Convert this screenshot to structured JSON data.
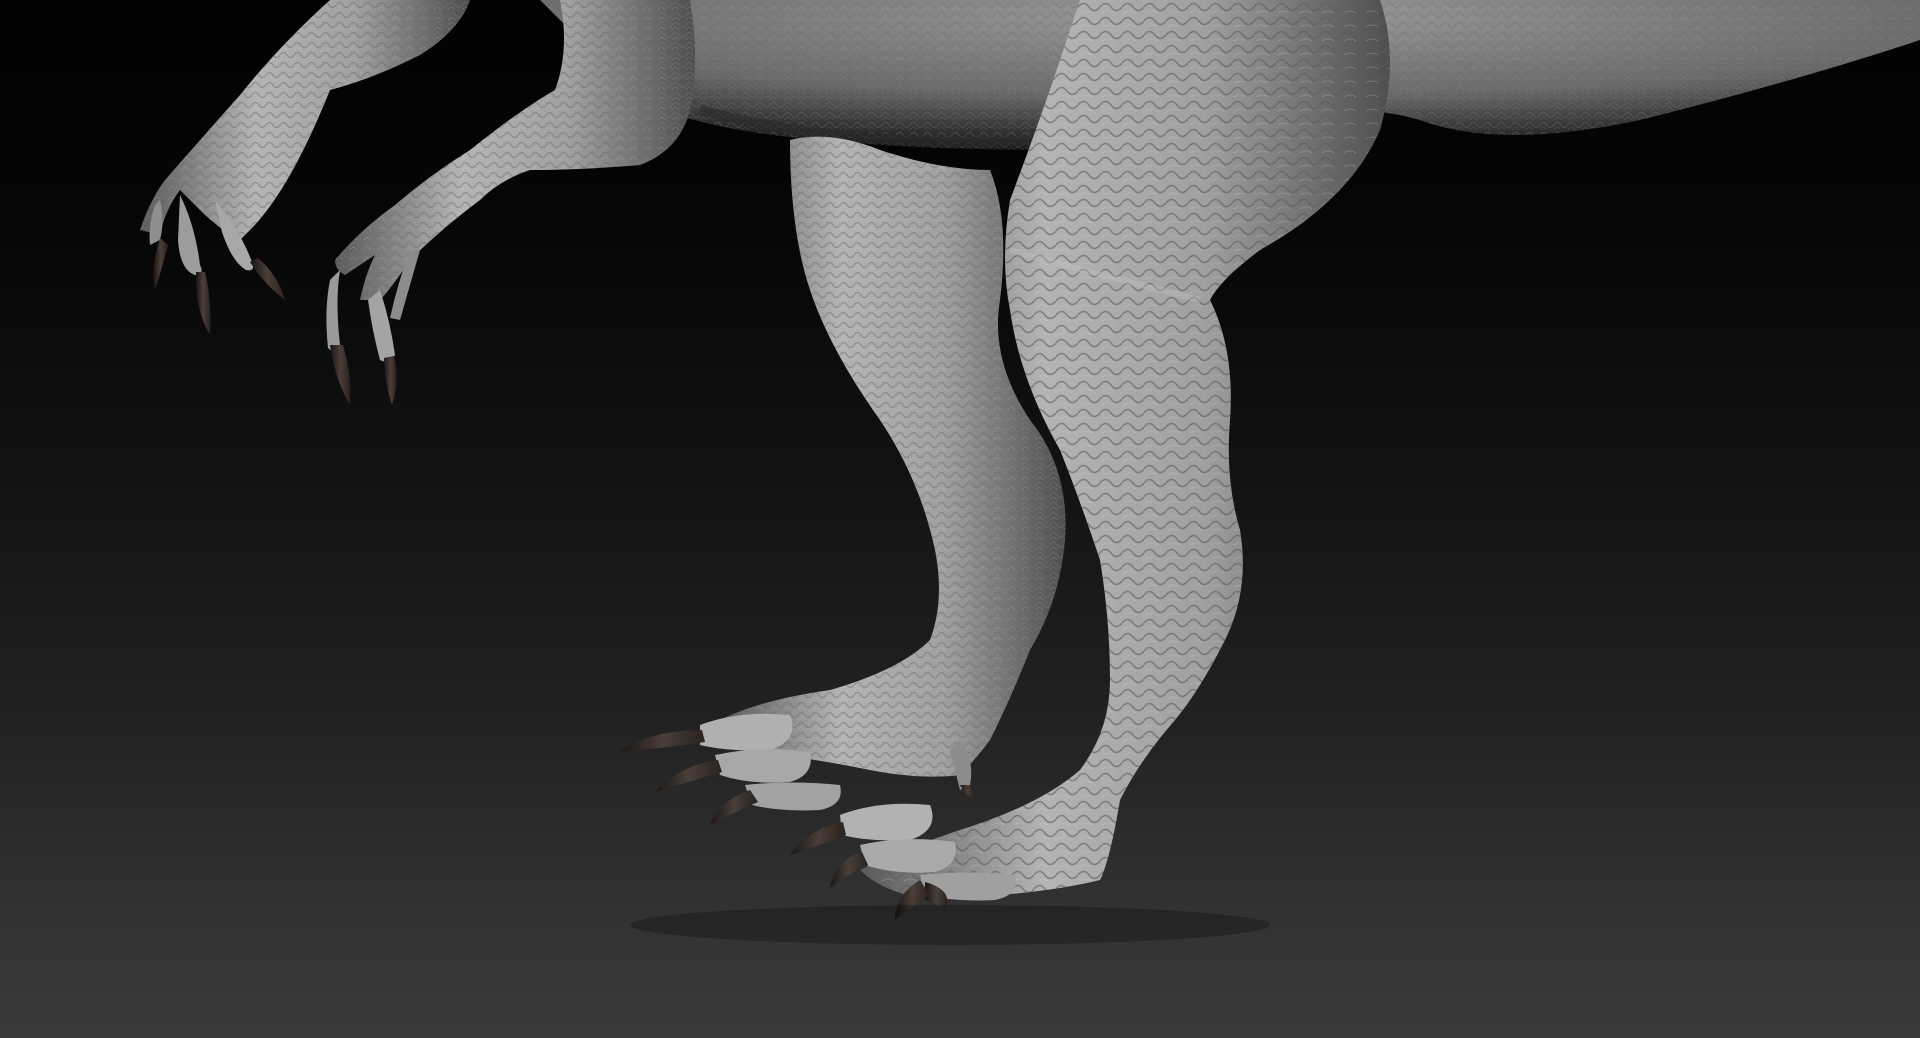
{
  "scene": {
    "background_top": "#020202",
    "background_bottom": "#3a3a3a",
    "skin_color": "#a9a9a9",
    "claw_color": "#2e2622"
  }
}
